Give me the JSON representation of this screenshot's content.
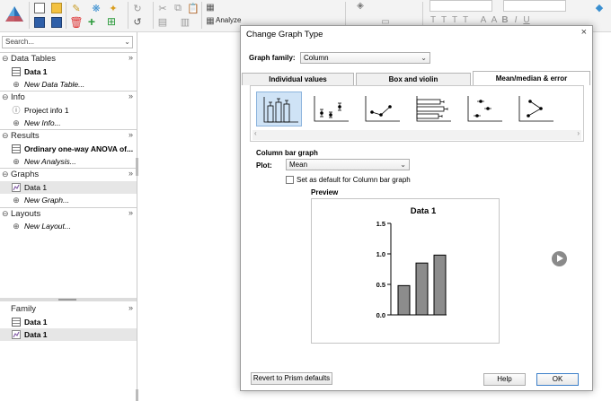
{
  "toolbar": {
    "analyze_label": "Analyze",
    "font_buttons": [
      "T",
      "T",
      "T",
      "T",
      "A",
      "A",
      "B",
      "I",
      "U"
    ]
  },
  "navigator": {
    "search_placeholder": "Search...",
    "sections": {
      "data_tables": "Data Tables",
      "info": "Info",
      "results": "Results",
      "graphs": "Graphs",
      "layouts": "Layouts",
      "family": "Family"
    },
    "items": {
      "data1": "Data 1",
      "new_data_table": "New Data Table...",
      "project_info": "Project info 1",
      "new_info": "New Info...",
      "anova": "Ordinary one-way ANOVA of...",
      "new_analysis": "New Analysis...",
      "graph_data1": "Data 1",
      "new_graph": "New Graph...",
      "new_layout": "New Layout...",
      "family_data1": "Data 1",
      "family_graph1": "Data 1"
    },
    "expand_glyph": "»",
    "collapse_glyph": "⊖",
    "new_glyph": "⊕"
  },
  "dialog": {
    "title": "Change Graph Type",
    "close": "×",
    "graph_family_label": "Graph family:",
    "graph_family_value": "Column",
    "tabs": [
      "Individual values",
      "Box and violin",
      "Mean/median & error"
    ],
    "active_tab": 2,
    "section_label": "Column bar graph",
    "plot_label": "Plot:",
    "plot_value": "Mean",
    "default_checkbox_label": "Set as default for Column bar graph",
    "default_checked": false,
    "preview_label": "Preview",
    "revert_button": "Revert to Prism defaults",
    "help_button": "Help",
    "ok_button": "OK"
  },
  "chart_data": {
    "type": "bar",
    "title": "Data 1",
    "categories": [
      "",
      "",
      ""
    ],
    "values": [
      0.48,
      0.85,
      0.98
    ],
    "ylim": [
      0,
      1.5
    ],
    "yticks": [
      "0.0",
      "0.5",
      "1.0",
      "1.5"
    ],
    "bar_color": "#8c8c8c",
    "grid": false
  }
}
